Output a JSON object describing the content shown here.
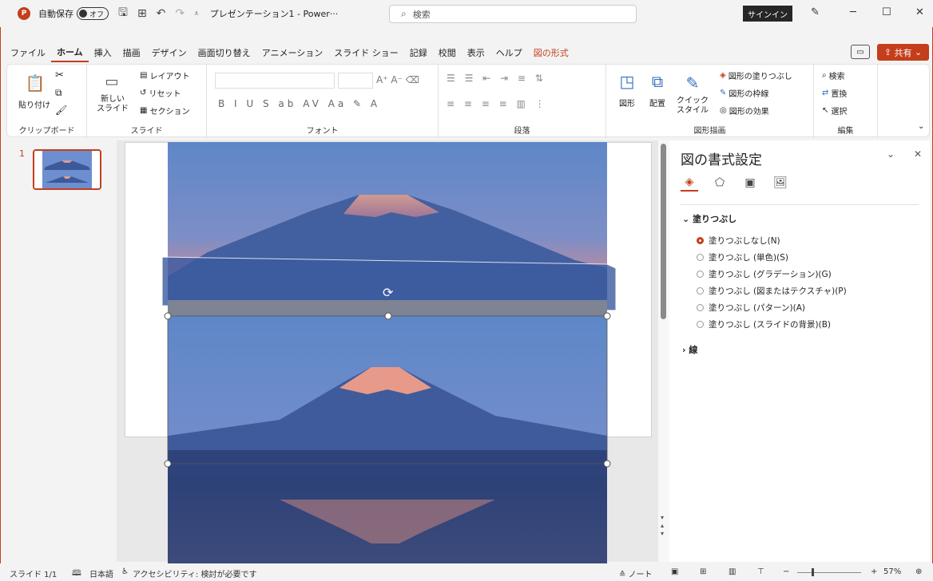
{
  "titlebar": {
    "app_logo": "P",
    "autosave_label": "自動保存",
    "autosave_state": "オフ",
    "doc_title": "プレゼンテーション1 - Power···",
    "search_placeholder": "検索",
    "signin_label": "サインイン"
  },
  "menu": {
    "tabs": [
      "ファイル",
      "ホーム",
      "挿入",
      "描画",
      "デザイン",
      "画面切り替え",
      "アニメーション",
      "スライド ショー",
      "記録",
      "校閲",
      "表示",
      "ヘルプ",
      "図の形式"
    ],
    "share_label": "共有"
  },
  "ribbon": {
    "clipboard": {
      "paste": "貼り付け",
      "group": "クリップボード"
    },
    "slides": {
      "new_slide": "新しい\nスライド",
      "layout": "レイアウト",
      "reset": "リセット",
      "section": "セクション",
      "group": "スライド"
    },
    "font": {
      "group": "フォント"
    },
    "paragraph": {
      "group": "段落"
    },
    "drawing": {
      "shapes": "図形",
      "arrange": "配置",
      "quick_styles": "クイック\nスタイル",
      "fill": "図形の塗りつぶし",
      "outline": "図形の枠線",
      "effects": "図形の効果",
      "group": "図形描画"
    },
    "editing": {
      "find": "検索",
      "replace": "置換",
      "select": "選択",
      "group": "編集"
    }
  },
  "slides_panel": {
    "thumb_number": "1"
  },
  "format_pane": {
    "title": "図の書式設定",
    "fill_section": "塗りつぶし",
    "fill_options": [
      {
        "label": "塗りつぶしなし(N)",
        "selected": true
      },
      {
        "label": "塗りつぶし (単色)(S)",
        "selected": false
      },
      {
        "label": "塗りつぶし (グラデーション)(G)",
        "selected": false
      },
      {
        "label": "塗りつぶし (図またはテクスチャ)(P)",
        "selected": false
      },
      {
        "label": "塗りつぶし (パターン)(A)",
        "selected": false
      },
      {
        "label": "塗りつぶし (スライドの背景)(B)",
        "selected": false
      }
    ],
    "line_section": "線"
  },
  "statusbar": {
    "slide_count": "スライド 1/1",
    "language": "日本語",
    "accessibility": "アクセシビリティ: 検討が必要です",
    "notes": "ノート",
    "zoom_percent": "57%"
  },
  "colors": {
    "accent": "#c43e1c",
    "sky_top": "#5e87c8",
    "sky_bottom": "#c58a9a",
    "mountain": "#3c5a9a",
    "snow": "#e89a8a"
  }
}
